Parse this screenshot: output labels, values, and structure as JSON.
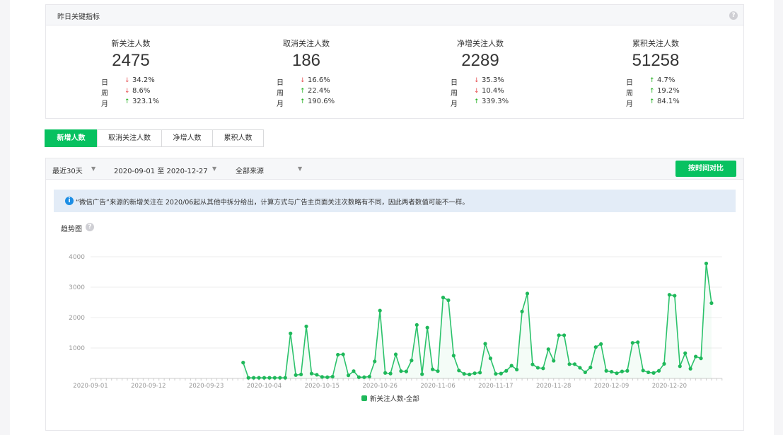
{
  "summary": {
    "title": "昨日关键指标",
    "metrics": [
      {
        "label": "新关注人数",
        "value": "2475",
        "rows": [
          {
            "period": "日",
            "dir": "down",
            "pct": "34.2%"
          },
          {
            "period": "周",
            "dir": "down",
            "pct": "8.6%"
          },
          {
            "period": "月",
            "dir": "up",
            "pct": "323.1%"
          }
        ]
      },
      {
        "label": "取消关注人数",
        "value": "186",
        "rows": [
          {
            "period": "日",
            "dir": "down",
            "pct": "16.6%"
          },
          {
            "period": "周",
            "dir": "up",
            "pct": "22.4%"
          },
          {
            "period": "月",
            "dir": "up",
            "pct": "190.6%"
          }
        ]
      },
      {
        "label": "净增关注人数",
        "value": "2289",
        "rows": [
          {
            "period": "日",
            "dir": "down",
            "pct": "35.3%"
          },
          {
            "period": "周",
            "dir": "down",
            "pct": "10.4%"
          },
          {
            "period": "月",
            "dir": "up",
            "pct": "339.3%"
          }
        ]
      },
      {
        "label": "累积关注人数",
        "value": "51258",
        "rows": [
          {
            "period": "日",
            "dir": "up",
            "pct": "4.7%"
          },
          {
            "period": "周",
            "dir": "up",
            "pct": "19.2%"
          },
          {
            "period": "月",
            "dir": "up",
            "pct": "84.1%"
          }
        ]
      }
    ]
  },
  "tabs": [
    "新增人数",
    "取消关注人数",
    "净增人数",
    "累积人数"
  ],
  "active_tab": "新增人数",
  "filters": {
    "range": "最近30天",
    "date_start": "2020-09-01",
    "date_sep": "至",
    "date_end": "2020-12-27",
    "source": "全部来源",
    "compare_button": "按时间对比"
  },
  "notice": "“微信广告”来源的新增关注在 2020/06起从其他中拆分给出，计算方式与广告主页面关注次数略有不同，因此两者数值可能不一样。",
  "chart_title": "趋势图",
  "icons": {
    "help": "question-circle-icon",
    "info": "info-circle-icon",
    "caret": "caret-down-icon",
    "arrow_up": "arrow-up-icon",
    "arrow_down": "arrow-down-icon"
  },
  "colors": {
    "accent": "#07c160",
    "up": "#1aad19",
    "down": "#e5494b",
    "line": "#2bc26b"
  },
  "chart_data": {
    "type": "line",
    "start_date": "2020-09-01",
    "xlabel": "",
    "ylabel": "",
    "ylim": [
      0,
      4000
    ],
    "yticks": [
      1000,
      2000,
      3000,
      4000
    ],
    "xtick_labels": [
      "2020-09-01",
      "2020-09-12",
      "2020-09-23",
      "2020-10-04",
      "2020-10-15",
      "2020-10-26",
      "2020-11-06",
      "2020-11-17",
      "2020-11-28",
      "2020-12-09",
      "2020-12-20"
    ],
    "grid": true,
    "legend_position": "bottom",
    "series": [
      {
        "name": "新关注人数-全部",
        "first_date": "2020-09-30",
        "values": [
          520,
          20,
          20,
          20,
          20,
          20,
          20,
          20,
          20,
          1480,
          110,
          130,
          1710,
          160,
          120,
          50,
          40,
          60,
          780,
          790,
          100,
          240,
          40,
          40,
          60,
          560,
          2230,
          180,
          160,
          790,
          240,
          230,
          590,
          1760,
          140,
          1670,
          300,
          240,
          2660,
          2570,
          750,
          260,
          150,
          130,
          170,
          190,
          1140,
          660,
          150,
          160,
          250,
          420,
          290,
          2200,
          2790,
          460,
          350,
          330,
          960,
          580,
          1420,
          1420,
          470,
          470,
          350,
          200,
          360,
          1030,
          1130,
          250,
          220,
          170,
          230,
          250,
          1170,
          1190,
          260,
          200,
          180,
          250,
          480,
          2750,
          2720,
          400,
          830,
          320,
          720,
          660,
          3780,
          2475
        ]
      }
    ]
  }
}
